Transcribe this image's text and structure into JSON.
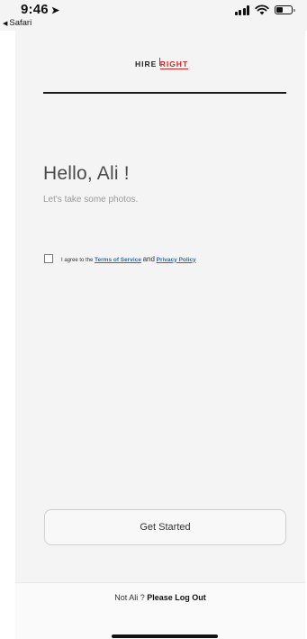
{
  "status_bar": {
    "time": "9:46",
    "back_app": "Safari"
  },
  "header": {
    "logo_left": "HIRE",
    "logo_right": "RIGHT"
  },
  "main": {
    "greeting": "Hello, Ali !",
    "subtitle": "Let's take some photos."
  },
  "consent": {
    "prefix": "I agree to the",
    "terms_label": "Terms of Service",
    "and_text": "and",
    "privacy_label": "Privacy Policy",
    "checked": false
  },
  "actions": {
    "get_started_label": "Get Started"
  },
  "footer": {
    "not_user": "Not Ali ?",
    "logout_label": "Please Log Out"
  },
  "colors": {
    "link": "#2a6db5",
    "brand_red": "#dd2222"
  }
}
